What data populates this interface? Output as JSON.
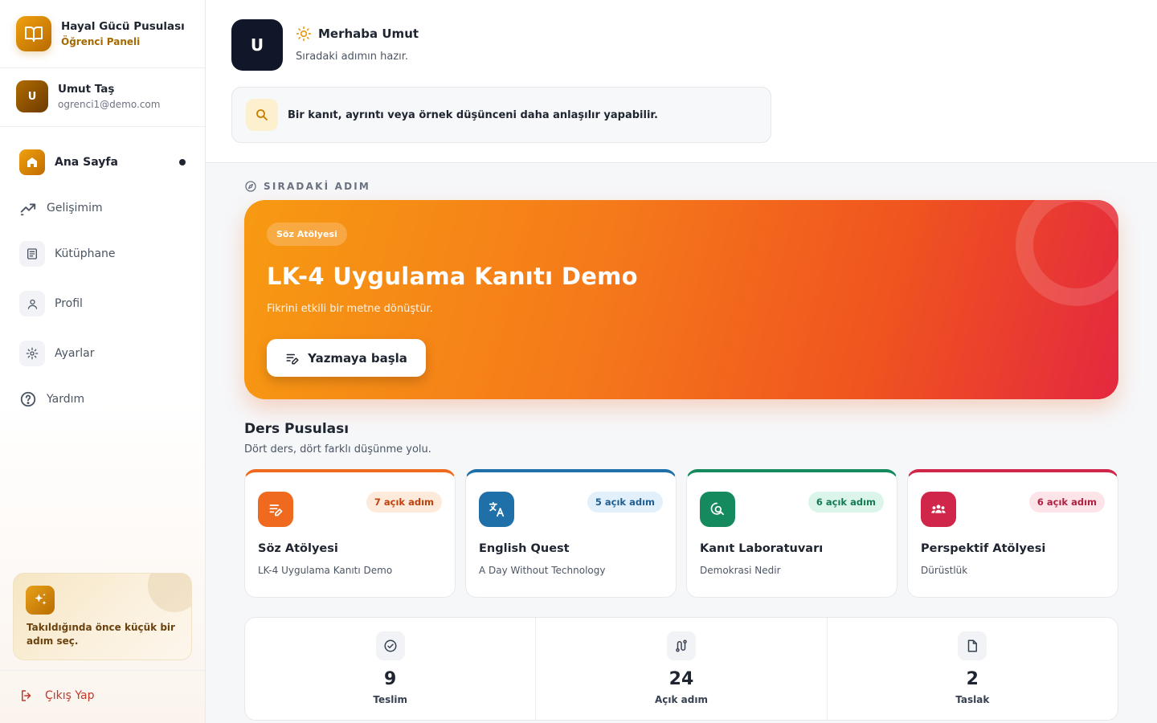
{
  "brand": {
    "title": "Hayal Gücü Pusulası",
    "subtitle": "Öğrenci Paneli"
  },
  "user": {
    "initial": "U",
    "name": "Umut Taş",
    "email": "ogrenci1@demo.com"
  },
  "nav": [
    {
      "label": "Ana Sayfa",
      "icon": "home-icon",
      "active": true
    },
    {
      "label": "Gelişimim",
      "icon": "trend-icon"
    },
    {
      "label": "Kütüphane",
      "icon": "library-icon"
    },
    {
      "label": "Profil",
      "icon": "user-icon"
    },
    {
      "label": "Ayarlar",
      "icon": "gear-icon"
    },
    {
      "label": "Yardım",
      "icon": "help-icon"
    }
  ],
  "tip": {
    "text": "Takıldığında önce küçük bir adım seç.",
    "icon": "sparkles-icon"
  },
  "logout": {
    "label": "Çıkış Yap",
    "icon": "logout-icon"
  },
  "header": {
    "avatar_initial": "U",
    "greeting": "Merhaba Umut",
    "subtitle": "Sıradaki adımın hazır.",
    "hint": "Bir kanıt, ayrıntı veya örnek düşünceni daha anlaşılır yapabilir."
  },
  "next_step": {
    "section_label": "SIRADAKİ ADIM",
    "tag": "Söz Atölyesi",
    "title": "LK-4 Uygulama Kanıtı Demo",
    "subtitle": "Fikrini etkili bir metne dönüştür.",
    "button": "Yazmaya başla"
  },
  "courses_section": {
    "title": "Ders Pusulası",
    "subtitle": "Dört ders, dört farklı düşünme yolu."
  },
  "courses": [
    {
      "badge": "7 açık adım",
      "title": "Söz Atölyesi",
      "subtitle": "LK-4 Uygulama Kanıtı Demo",
      "icon": "pen-lines-icon",
      "color": "#ef6a1e"
    },
    {
      "badge": "5 açık adım",
      "title": "English Quest",
      "subtitle": "A Day Without Technology",
      "icon": "translate-icon",
      "color": "#1f6fa8"
    },
    {
      "badge": "6 açık adım",
      "title": "Kanıt Laboratuvarı",
      "subtitle": "Demokrasi Nedir",
      "icon": "search-evidence-icon",
      "color": "#158a5e"
    },
    {
      "badge": "6 açık adım",
      "title": "Perspektif Atölyesi",
      "subtitle": "Dürüstlük",
      "icon": "people-icon",
      "color": "#d0264a"
    }
  ],
  "stats": [
    {
      "value": "9",
      "label": "Teslim",
      "icon": "check-circle-icon"
    },
    {
      "value": "24",
      "label": "Açık adım",
      "icon": "route-icon"
    },
    {
      "value": "2",
      "label": "Taslak",
      "icon": "file-icon"
    }
  ]
}
